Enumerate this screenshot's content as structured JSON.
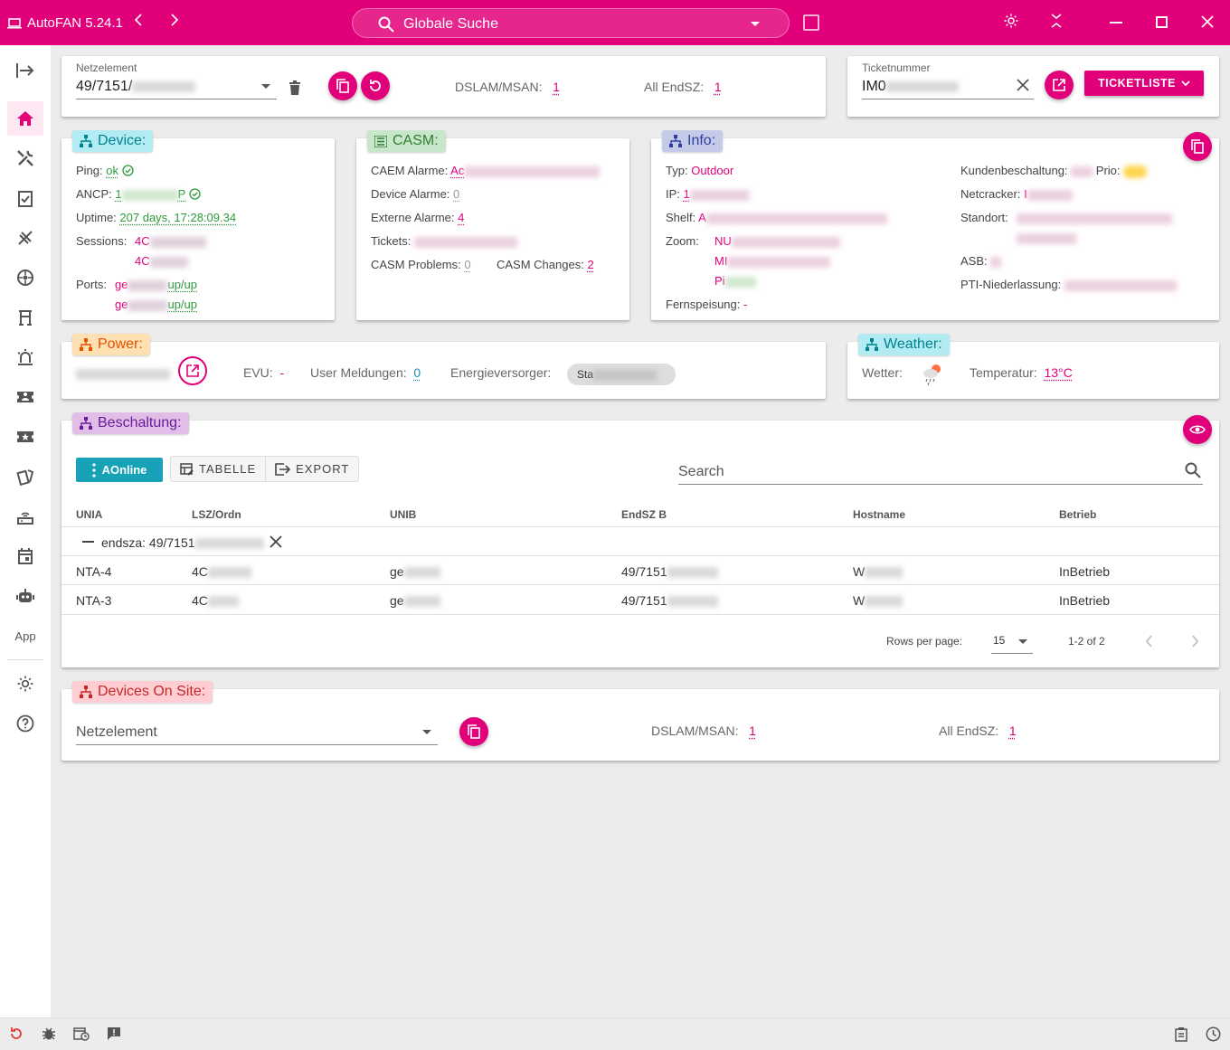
{
  "window": {
    "title": "AutoFAN 5.24.1",
    "search_placeholder": "Globale Suche"
  },
  "sidebar": {
    "app_label": "App"
  },
  "network_element": {
    "label": "Netzelement",
    "value": "49/7151/",
    "dslam_label": "DSLAM/MSAN:",
    "dslam_value": "1",
    "endsz_label": "All EndSZ:",
    "endsz_value": "1"
  },
  "ticket": {
    "label": "Ticketnummer",
    "value": "IM0",
    "list_button": "TICKETLISTE"
  },
  "device": {
    "title": "Device:",
    "ping_label": "Ping:",
    "ping_value": "ok",
    "ancp_label": "ANCP:",
    "ancp_value_a": "1",
    "ancp_value_b": "P",
    "uptime_label": "Uptime:",
    "uptime_value": "207 days, 17:28:09.34",
    "sessions_label": "Sessions:",
    "session1": "4C",
    "session2": "4C",
    "ports_label": "Ports:",
    "port1_prefix": "ge",
    "port1_status": "up/up",
    "port2_prefix": "ge",
    "port2_status": "up/up"
  },
  "casm": {
    "title": "CASM:",
    "caem_label": "CAEM Alarme:",
    "caem_value": "Ac",
    "device_alarm_label": "Device Alarme:",
    "device_alarm_value": "0",
    "external_label": "Externe Alarme:",
    "external_value": "4",
    "tickets_label": "Tickets:",
    "problems_label": "CASM Problems:",
    "problems_value": "0",
    "changes_label": "CASM Changes:",
    "changes_value": "2"
  },
  "info": {
    "title": "Info:",
    "typ_label": "Typ:",
    "typ_value": "Outdoor",
    "ip_label": "IP:",
    "ip_value": "1",
    "shelf_label": "Shelf:",
    "shelf_value": "A",
    "zoom_label": "Zoom:",
    "zoom1": "NU",
    "zoom2": "MI",
    "zoom3": "Pi",
    "fern_label": "Fernspeisung:",
    "fern_value": "-",
    "kunden_label": "Kundenbeschaltung:",
    "prio_label": "Prio:",
    "netcracker_label": "Netcracker:",
    "netcracker_value": "I",
    "standort_label": "Standort:",
    "asb_label": "ASB:",
    "pti_label": "PTI-Niederlassung:"
  },
  "power": {
    "title": "Power:",
    "evu_label": "EVU:",
    "evu_value": "-",
    "user_label": "User Meldungen:",
    "user_value": "0",
    "energie_label": "Energieversorger:",
    "energie_value": "Sta"
  },
  "weather": {
    "title": "Weather:",
    "wetter_label": "Wetter:",
    "temp_label": "Temperatur:",
    "temp_value": "13°C"
  },
  "beschaltung": {
    "title": "Beschaltung:",
    "aonline_button": "AOnline",
    "tabelle_button": "TABELLE",
    "export_button": "EXPORT",
    "search_placeholder": "Search",
    "columns": [
      "UNIA",
      "LSZ/Ordn",
      "UNIB",
      "EndSZ B",
      "Hostname",
      "Betrieb"
    ],
    "group_label": "endsza: 49/7151",
    "rows": [
      {
        "unia": "NTA-4",
        "lsz": "4C",
        "unib": "ge",
        "endsz": "49/7151",
        "host": "W",
        "betrieb": "InBetrieb"
      },
      {
        "unia": "NTA-3",
        "lsz": "4C",
        "unib": "ge",
        "endsz": "49/7151",
        "host": "W",
        "betrieb": "InBetrieb"
      }
    ],
    "rows_per_page_label": "Rows per page:",
    "rows_per_page_value": "15",
    "range": "1-2 of 2"
  },
  "devices_on_site": {
    "title": "Devices On Site:",
    "placeholder": "Netzelement",
    "dslam_label": "DSLAM/MSAN:",
    "dslam_value": "1",
    "endsz_label": "All EndSZ:",
    "endsz_value": "1"
  },
  "colors": {
    "brand": "#e2007a",
    "teal": "#17a2b8",
    "ok_green": "#2e9a3c"
  }
}
